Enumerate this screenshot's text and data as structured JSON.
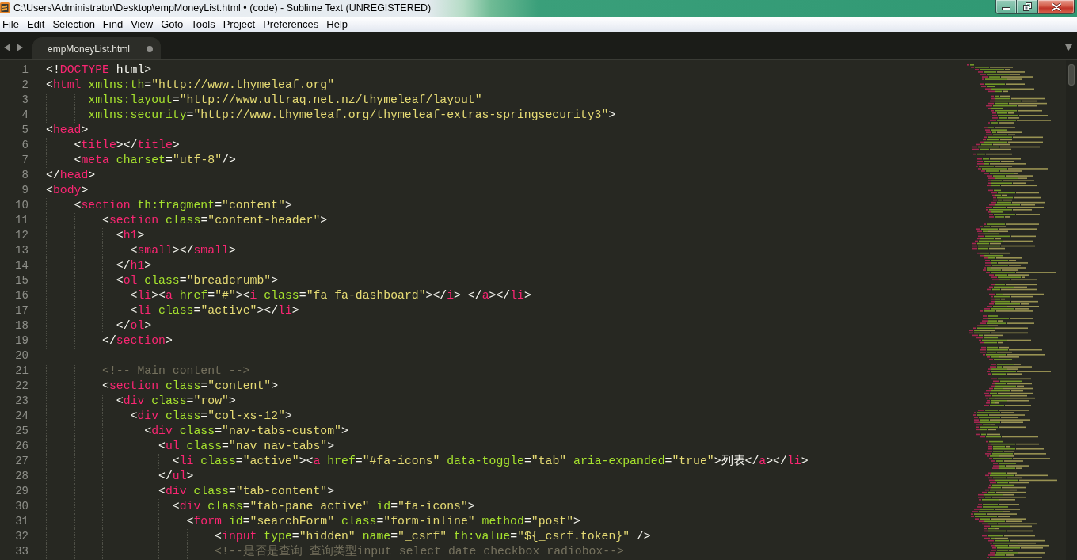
{
  "window": {
    "title": "C:\\Users\\Administrator\\Desktop\\empMoneyList.html • (code) - Sublime Text (UNREGISTERED)"
  },
  "menu": [
    {
      "key": "F",
      "post": "ile"
    },
    {
      "key": "E",
      "post": "dit"
    },
    {
      "key": "S",
      "post": "election"
    },
    {
      "pre": "F",
      "key": "i",
      "post": "nd"
    },
    {
      "key": "V",
      "post": "iew"
    },
    {
      "key": "G",
      "post": "oto"
    },
    {
      "key": "T",
      "post": "ools"
    },
    {
      "key": "P",
      "post": "roject"
    },
    {
      "pre": "Prefere",
      "key": "n",
      "post": "ces"
    },
    {
      "key": "H",
      "post": "elp"
    }
  ],
  "tabs": [
    {
      "label": "empMoneyList.html",
      "selected": true,
      "modified": true
    }
  ],
  "editor": {
    "lines": [
      {
        "number": "1",
        "tokens": [
          {
            "kind": "punct",
            "text": "<!"
          },
          {
            "kind": "tag",
            "text": "DOCTYPE"
          },
          {
            "kind": "punct",
            "text": " html>"
          }
        ]
      },
      {
        "number": "2",
        "tokens": [
          {
            "kind": "punct",
            "text": "<"
          },
          {
            "kind": "tag",
            "text": "html"
          },
          {
            "kind": "attr",
            "text": " xmlns:th"
          },
          {
            "kind": "punct",
            "text": "="
          },
          {
            "kind": "string",
            "text": "\"http://www.thymeleaf.org\""
          }
        ]
      },
      {
        "number": "3",
        "tokens": [
          {
            "kind": "attr",
            "text": "      xmlns:layout"
          },
          {
            "kind": "punct",
            "text": "="
          },
          {
            "kind": "string",
            "text": "\"http://www.ultraq.net.nz/thymeleaf/layout\""
          }
        ]
      },
      {
        "number": "4",
        "tokens": [
          {
            "kind": "attr",
            "text": "      xmlns:security"
          },
          {
            "kind": "punct",
            "text": "="
          },
          {
            "kind": "string",
            "text": "\"http://www.thymeleaf.org/thymeleaf-extras-springsecurity3\""
          },
          {
            "kind": "punct",
            "text": ">"
          }
        ]
      },
      {
        "number": "5",
        "tokens": [
          {
            "kind": "punct",
            "text": "<"
          },
          {
            "kind": "tag",
            "text": "head"
          },
          {
            "kind": "punct",
            "text": ">"
          }
        ]
      },
      {
        "number": "6",
        "tokens": [
          {
            "kind": "punct",
            "text": "    <"
          },
          {
            "kind": "tag",
            "text": "title"
          },
          {
            "kind": "punct",
            "text": "></"
          },
          {
            "kind": "tag",
            "text": "title"
          },
          {
            "kind": "punct",
            "text": ">"
          }
        ]
      },
      {
        "number": "7",
        "tokens": [
          {
            "kind": "punct",
            "text": "    <"
          },
          {
            "kind": "tag",
            "text": "meta"
          },
          {
            "kind": "attr",
            "text": " charset"
          },
          {
            "kind": "punct",
            "text": "="
          },
          {
            "kind": "string",
            "text": "\"utf-8\""
          },
          {
            "kind": "punct",
            "text": "/>"
          }
        ]
      },
      {
        "number": "8",
        "tokens": [
          {
            "kind": "punct",
            "text": "</"
          },
          {
            "kind": "tag",
            "text": "head"
          },
          {
            "kind": "punct",
            "text": ">"
          }
        ]
      },
      {
        "number": "9",
        "tokens": [
          {
            "kind": "punct",
            "text": "<"
          },
          {
            "kind": "tag",
            "text": "body"
          },
          {
            "kind": "punct",
            "text": ">"
          }
        ]
      },
      {
        "number": "10",
        "tokens": [
          {
            "kind": "punct",
            "text": "    <"
          },
          {
            "kind": "tag",
            "text": "section"
          },
          {
            "kind": "attr",
            "text": " th:fragment"
          },
          {
            "kind": "punct",
            "text": "="
          },
          {
            "kind": "string",
            "text": "\"content\""
          },
          {
            "kind": "punct",
            "text": ">"
          }
        ]
      },
      {
        "number": "11",
        "tokens": [
          {
            "kind": "punct",
            "text": "        <"
          },
          {
            "kind": "tag",
            "text": "section"
          },
          {
            "kind": "attr",
            "text": " class"
          },
          {
            "kind": "punct",
            "text": "="
          },
          {
            "kind": "string",
            "text": "\"content-header\""
          },
          {
            "kind": "punct",
            "text": ">"
          }
        ]
      },
      {
        "number": "12",
        "tokens": [
          {
            "kind": "punct",
            "text": "          <"
          },
          {
            "kind": "tag",
            "text": "h1"
          },
          {
            "kind": "punct",
            "text": ">"
          }
        ]
      },
      {
        "number": "13",
        "tokens": [
          {
            "kind": "punct",
            "text": "            <"
          },
          {
            "kind": "tag",
            "text": "small"
          },
          {
            "kind": "punct",
            "text": "></"
          },
          {
            "kind": "tag",
            "text": "small"
          },
          {
            "kind": "punct",
            "text": ">"
          }
        ]
      },
      {
        "number": "14",
        "tokens": [
          {
            "kind": "punct",
            "text": "          </"
          },
          {
            "kind": "tag",
            "text": "h1"
          },
          {
            "kind": "punct",
            "text": ">"
          }
        ]
      },
      {
        "number": "15",
        "tokens": [
          {
            "kind": "punct",
            "text": "          <"
          },
          {
            "kind": "tag",
            "text": "ol"
          },
          {
            "kind": "attr",
            "text": " class"
          },
          {
            "kind": "punct",
            "text": "="
          },
          {
            "kind": "string",
            "text": "\"breadcrumb\""
          },
          {
            "kind": "punct",
            "text": ">"
          }
        ]
      },
      {
        "number": "16",
        "tokens": [
          {
            "kind": "punct",
            "text": "            <"
          },
          {
            "kind": "tag",
            "text": "li"
          },
          {
            "kind": "punct",
            "text": "><"
          },
          {
            "kind": "tag",
            "text": "a"
          },
          {
            "kind": "attr",
            "text": " href"
          },
          {
            "kind": "punct",
            "text": "="
          },
          {
            "kind": "string",
            "text": "\"#\""
          },
          {
            "kind": "punct",
            "text": "><"
          },
          {
            "kind": "tag",
            "text": "i"
          },
          {
            "kind": "attr",
            "text": " class"
          },
          {
            "kind": "punct",
            "text": "="
          },
          {
            "kind": "string",
            "text": "\"fa fa-dashboard\""
          },
          {
            "kind": "punct",
            "text": "></"
          },
          {
            "kind": "tag",
            "text": "i"
          },
          {
            "kind": "punct",
            "text": "> </"
          },
          {
            "kind": "tag",
            "text": "a"
          },
          {
            "kind": "punct",
            "text": "></"
          },
          {
            "kind": "tag",
            "text": "li"
          },
          {
            "kind": "punct",
            "text": ">"
          }
        ]
      },
      {
        "number": "17",
        "tokens": [
          {
            "kind": "punct",
            "text": "            <"
          },
          {
            "kind": "tag",
            "text": "li"
          },
          {
            "kind": "attr",
            "text": " class"
          },
          {
            "kind": "punct",
            "text": "="
          },
          {
            "kind": "string",
            "text": "\"active\""
          },
          {
            "kind": "punct",
            "text": "></"
          },
          {
            "kind": "tag",
            "text": "li"
          },
          {
            "kind": "punct",
            "text": ">"
          }
        ]
      },
      {
        "number": "18",
        "tokens": [
          {
            "kind": "punct",
            "text": "          </"
          },
          {
            "kind": "tag",
            "text": "ol"
          },
          {
            "kind": "punct",
            "text": ">"
          }
        ]
      },
      {
        "number": "19",
        "tokens": [
          {
            "kind": "punct",
            "text": "        </"
          },
          {
            "kind": "tag",
            "text": "section"
          },
          {
            "kind": "punct",
            "text": ">"
          }
        ]
      },
      {
        "number": "20"
      },
      {
        "number": "21",
        "tokens": [
          {
            "kind": "comment",
            "text": "        <!-- Main content -->"
          }
        ]
      },
      {
        "number": "22",
        "tokens": [
          {
            "kind": "punct",
            "text": "        <"
          },
          {
            "kind": "tag",
            "text": "section"
          },
          {
            "kind": "attr",
            "text": " class"
          },
          {
            "kind": "punct",
            "text": "="
          },
          {
            "kind": "string",
            "text": "\"content\""
          },
          {
            "kind": "punct",
            "text": ">"
          }
        ]
      },
      {
        "number": "23",
        "tokens": [
          {
            "kind": "punct",
            "text": "          <"
          },
          {
            "kind": "tag",
            "text": "div"
          },
          {
            "kind": "attr",
            "text": " class"
          },
          {
            "kind": "punct",
            "text": "="
          },
          {
            "kind": "string",
            "text": "\"row\""
          },
          {
            "kind": "punct",
            "text": ">"
          }
        ]
      },
      {
        "number": "24",
        "tokens": [
          {
            "kind": "punct",
            "text": "            <"
          },
          {
            "kind": "tag",
            "text": "div"
          },
          {
            "kind": "attr",
            "text": " class"
          },
          {
            "kind": "punct",
            "text": "="
          },
          {
            "kind": "string",
            "text": "\"col-xs-12\""
          },
          {
            "kind": "punct",
            "text": ">"
          }
        ]
      },
      {
        "number": "25",
        "tokens": [
          {
            "kind": "punct",
            "text": "              <"
          },
          {
            "kind": "tag",
            "text": "div"
          },
          {
            "kind": "attr",
            "text": " class"
          },
          {
            "kind": "punct",
            "text": "="
          },
          {
            "kind": "string",
            "text": "\"nav-tabs-custom\""
          },
          {
            "kind": "punct",
            "text": ">"
          }
        ]
      },
      {
        "number": "26",
        "tokens": [
          {
            "kind": "punct",
            "text": "                <"
          },
          {
            "kind": "tag",
            "text": "ul"
          },
          {
            "kind": "attr",
            "text": " class"
          },
          {
            "kind": "punct",
            "text": "="
          },
          {
            "kind": "string",
            "text": "\"nav nav-tabs\""
          },
          {
            "kind": "punct",
            "text": ">"
          }
        ]
      },
      {
        "number": "27",
        "tokens": [
          {
            "kind": "punct",
            "text": "                  <"
          },
          {
            "kind": "tag",
            "text": "li"
          },
          {
            "kind": "attr",
            "text": " class"
          },
          {
            "kind": "punct",
            "text": "="
          },
          {
            "kind": "string",
            "text": "\"active\""
          },
          {
            "kind": "punct",
            "text": "><"
          },
          {
            "kind": "tag",
            "text": "a"
          },
          {
            "kind": "attr",
            "text": " href"
          },
          {
            "kind": "punct",
            "text": "="
          },
          {
            "kind": "string",
            "text": "\"#fa-icons\""
          },
          {
            "kind": "attr",
            "text": " data-toggle"
          },
          {
            "kind": "punct",
            "text": "="
          },
          {
            "kind": "string",
            "text": "\"tab\""
          },
          {
            "kind": "attr",
            "text": " aria-expanded"
          },
          {
            "kind": "punct",
            "text": "="
          },
          {
            "kind": "string",
            "text": "\"true\""
          },
          {
            "kind": "punct",
            "text": ">列表</"
          },
          {
            "kind": "tag",
            "text": "a"
          },
          {
            "kind": "punct",
            "text": "></"
          },
          {
            "kind": "tag",
            "text": "li"
          },
          {
            "kind": "punct",
            "text": ">"
          }
        ]
      },
      {
        "number": "28",
        "tokens": [
          {
            "kind": "punct",
            "text": "                </"
          },
          {
            "kind": "tag",
            "text": "ul"
          },
          {
            "kind": "punct",
            "text": ">"
          }
        ]
      },
      {
        "number": "29",
        "tokens": [
          {
            "kind": "punct",
            "text": "                <"
          },
          {
            "kind": "tag",
            "text": "div"
          },
          {
            "kind": "attr",
            "text": " class"
          },
          {
            "kind": "punct",
            "text": "="
          },
          {
            "kind": "string",
            "text": "\"tab-content\""
          },
          {
            "kind": "punct",
            "text": ">"
          }
        ]
      },
      {
        "number": "30",
        "tokens": [
          {
            "kind": "punct",
            "text": "                  <"
          },
          {
            "kind": "tag",
            "text": "div"
          },
          {
            "kind": "attr",
            "text": " class"
          },
          {
            "kind": "punct",
            "text": "="
          },
          {
            "kind": "string",
            "text": "\"tab-pane active\""
          },
          {
            "kind": "attr",
            "text": " id"
          },
          {
            "kind": "punct",
            "text": "="
          },
          {
            "kind": "string",
            "text": "\"fa-icons\""
          },
          {
            "kind": "punct",
            "text": ">"
          }
        ]
      },
      {
        "number": "31",
        "tokens": [
          {
            "kind": "punct",
            "text": "                    <"
          },
          {
            "kind": "tag",
            "text": "form"
          },
          {
            "kind": "attr",
            "text": " id"
          },
          {
            "kind": "punct",
            "text": "="
          },
          {
            "kind": "string",
            "text": "\"searchForm\""
          },
          {
            "kind": "attr",
            "text": " class"
          },
          {
            "kind": "punct",
            "text": "="
          },
          {
            "kind": "string",
            "text": "\"form-inline\""
          },
          {
            "kind": "attr",
            "text": " method"
          },
          {
            "kind": "punct",
            "text": "="
          },
          {
            "kind": "string",
            "text": "\"post\""
          },
          {
            "kind": "punct",
            "text": ">"
          }
        ]
      },
      {
        "number": "32",
        "tokens": [
          {
            "kind": "punct",
            "text": "                        <"
          },
          {
            "kind": "tag",
            "text": "input"
          },
          {
            "kind": "attr",
            "text": " type"
          },
          {
            "kind": "punct",
            "text": "="
          },
          {
            "kind": "string",
            "text": "\"hidden\""
          },
          {
            "kind": "attr",
            "text": " name"
          },
          {
            "kind": "punct",
            "text": "="
          },
          {
            "kind": "string",
            "text": "\"_csrf\""
          },
          {
            "kind": "attr",
            "text": " th:value"
          },
          {
            "kind": "punct",
            "text": "="
          },
          {
            "kind": "string",
            "text": "\"${_csrf.token}\""
          },
          {
            "kind": "punct",
            "text": " />"
          }
        ]
      },
      {
        "number": "33",
        "tokens": [
          {
            "kind": "comment",
            "text": "                        <!--是否是查询 查询类型input select date checkbox radiobox-->"
          }
        ]
      }
    ]
  }
}
